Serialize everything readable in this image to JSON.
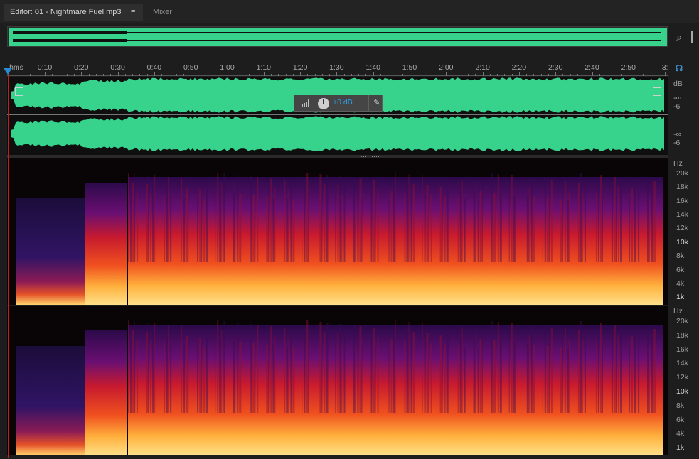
{
  "tabs": {
    "editor_label": "Editor: 01 - Nightmare Fuel.mp3",
    "editor_menu": "≡",
    "mixer_label": "Mixer"
  },
  "timeline": {
    "unit_label": "hms",
    "ticks": [
      "0:10",
      "0:20",
      "0:30",
      "0:40",
      "0:50",
      "1:00",
      "1:10",
      "1:20",
      "1:30",
      "1:40",
      "1:50",
      "2:00",
      "2:10",
      "2:20",
      "2:30",
      "2:40",
      "2:50",
      "3:"
    ]
  },
  "waveform_scale": {
    "top": {
      "db": "dB",
      "minus_inf": "-∞",
      "minus_six": "-6"
    },
    "bottom": {
      "minus_inf": "-∞",
      "minus_six": "-6"
    }
  },
  "spectral_scale": {
    "unit": "Hz",
    "labels": [
      "20k",
      "18k",
      "16k",
      "14k",
      "12k",
      "10k",
      "8k",
      "6k",
      "4k",
      "1k"
    ]
  },
  "hud": {
    "gain_value": "+0 dB"
  },
  "icons": {
    "zoom": "zoom-icon",
    "headphones": "headphones-icon",
    "pin": "pin-icon"
  },
  "colors": {
    "waveform_fill": "#37d38c",
    "playhead": "#b22222",
    "accent": "#2da2e8"
  }
}
